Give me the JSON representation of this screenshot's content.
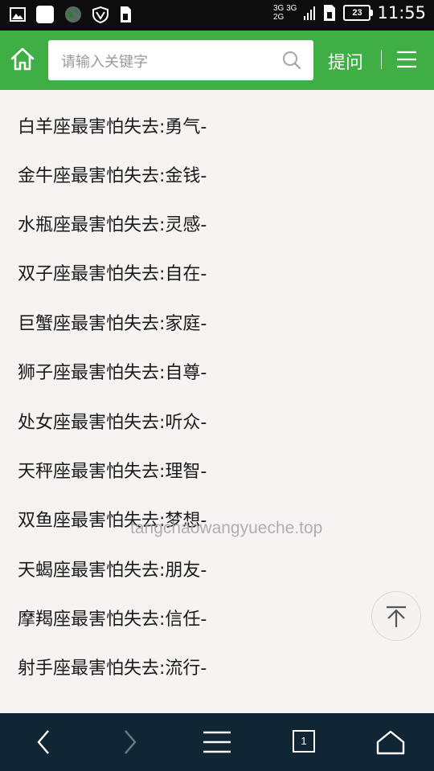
{
  "status_bar": {
    "network_top": "3G 3G",
    "network_bottom": "2G",
    "battery": "23",
    "time": "11:55",
    "icons": [
      "gallery-icon",
      "notification-icon",
      "globe-icon",
      "vpn-icon",
      "sim-icon",
      "signal-icon",
      "sim-card-icon"
    ]
  },
  "header": {
    "home_icon": "home-icon",
    "search_placeholder": "请输入关键字",
    "ask_label": "提问",
    "menu_icon": "menu-icon"
  },
  "list": {
    "items": [
      "白羊座最害怕失去:勇气-",
      "金牛座最害怕失去:金钱-",
      "水瓶座最害怕失去:灵感-",
      "双子座最害怕失去:自在-",
      "巨蟹座最害怕失去:家庭-",
      "狮子座最害怕失去:自尊-",
      "处女座最害怕失去:听众-",
      "天秤座最害怕失去:理智-",
      "双鱼座最害怕失去:梦想-",
      "天蝎座最害怕失去:朋友-",
      "摩羯座最害怕失去:信任-",
      "射手座最害怕失去:流行-"
    ]
  },
  "watermark": "tangchaowangyueche.top",
  "bottom_nav": {
    "tab_count": "1",
    "icons": [
      "back-icon",
      "forward-icon",
      "menu-icon",
      "tabs-icon",
      "home-icon"
    ]
  },
  "colors": {
    "header_green": "#3fae45",
    "bottom_bar": "#102634",
    "background": "#f8f3f3"
  }
}
